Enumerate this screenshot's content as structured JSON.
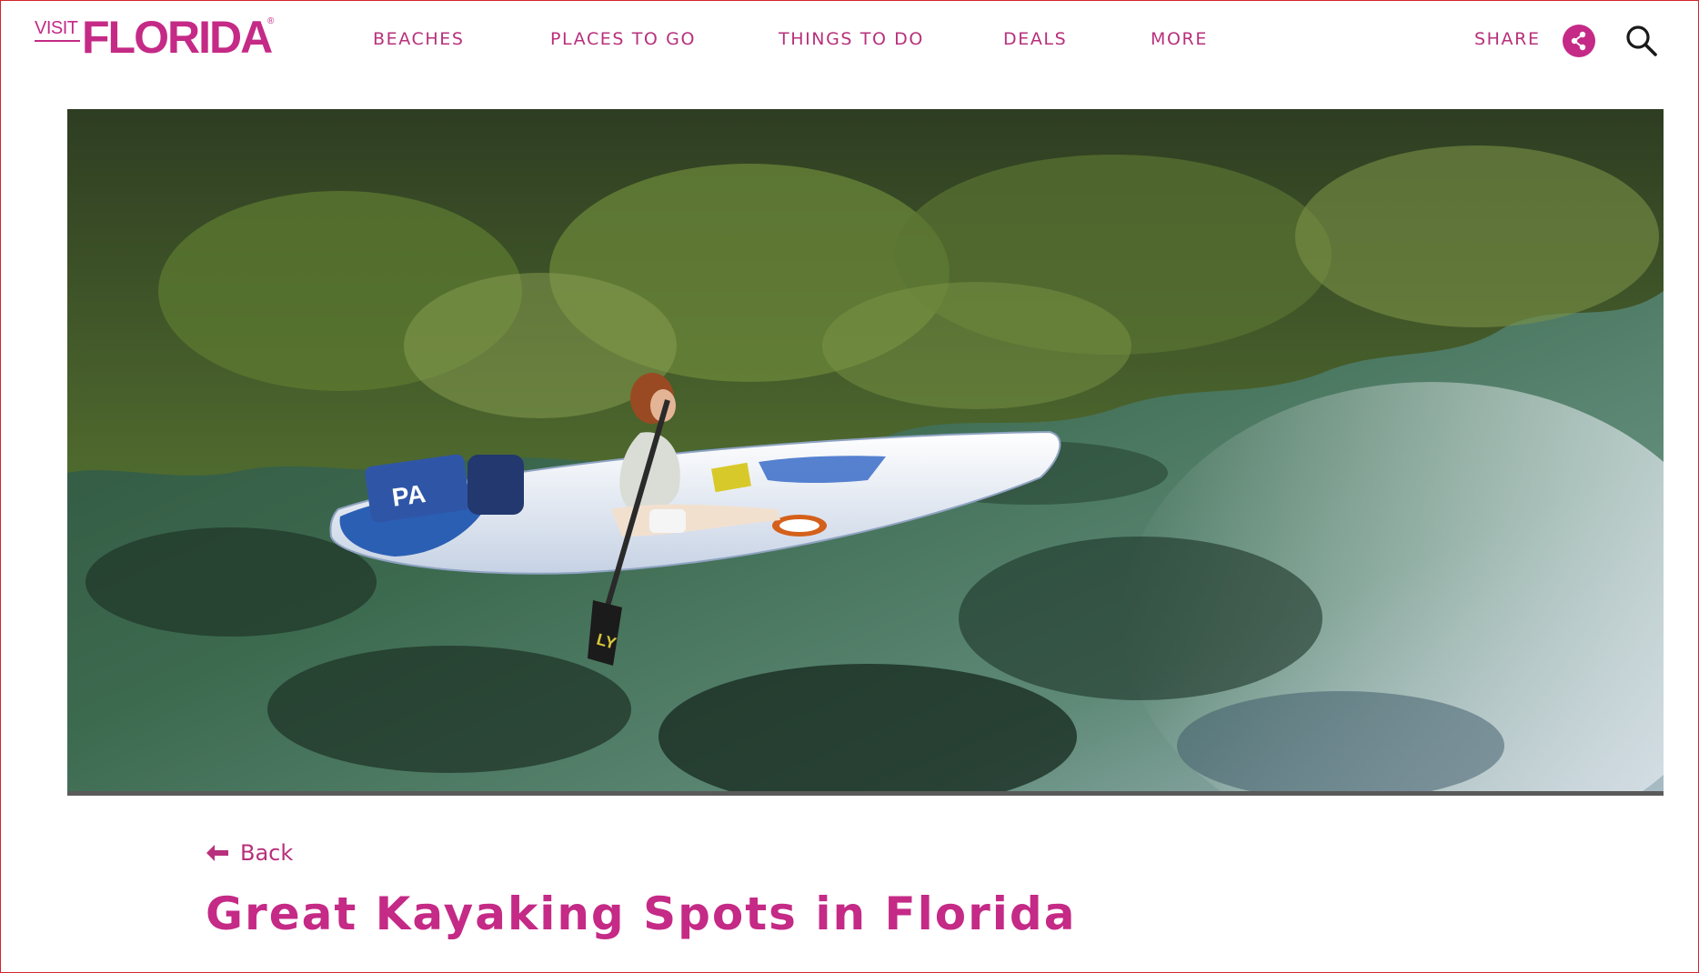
{
  "brand": {
    "visit": "VISIT",
    "name": "FLORIDA",
    "registered": "®",
    "color": "#c42a86"
  },
  "nav": {
    "items": [
      {
        "label": "BEACHES"
      },
      {
        "label": "PLACES TO GO"
      },
      {
        "label": "THINGS TO DO"
      },
      {
        "label": "DEALS"
      },
      {
        "label": "MORE"
      }
    ],
    "share_label": "SHARE",
    "share_icon": "share-icon",
    "search_icon": "search-icon"
  },
  "hero": {
    "image_subject": "kayaker-on-clear-spring",
    "kayak_label": "PA"
  },
  "content": {
    "back_label": "Back",
    "title": "Great Kayaking Spots in Florida"
  }
}
